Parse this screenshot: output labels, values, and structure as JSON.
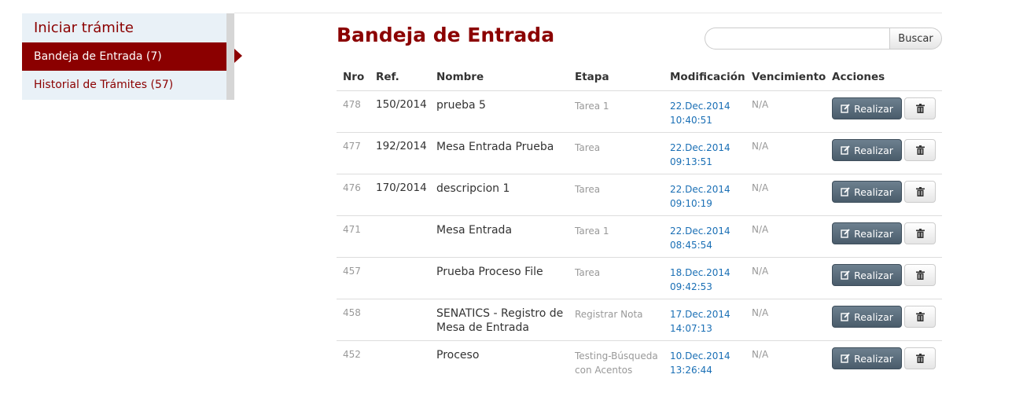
{
  "sidebar": {
    "start_label": "Iniciar trámite",
    "inbox_label": "Bandeja de Entrada (7)",
    "history_label": "Historial de Trámites (57)"
  },
  "main": {
    "title": "Bandeja de Entrada",
    "search": {
      "placeholder": "",
      "value": "",
      "button_label": "Buscar"
    }
  },
  "table": {
    "headers": {
      "nro": "Nro",
      "ref": "Ref.",
      "nombre": "Nombre",
      "etapa": "Etapa",
      "modificacion": "Modificación",
      "vencimiento": "Vencimiento",
      "acciones": "Acciones"
    },
    "rows": [
      {
        "nro": "478",
        "ref": "150/2014",
        "nombre": "prueba 5",
        "etapa": "Tarea 1",
        "fecha": "22.Dec.2014",
        "hora": "10:40:51",
        "vencimiento": "N/A",
        "accion": "Realizar"
      },
      {
        "nro": "477",
        "ref": "192/2014",
        "nombre": "Mesa Entrada Prueba",
        "etapa": "Tarea",
        "fecha": "22.Dec.2014",
        "hora": "09:13:51",
        "vencimiento": "N/A",
        "accion": "Realizar"
      },
      {
        "nro": "476",
        "ref": "170/2014",
        "nombre": "descripcion 1",
        "etapa": "Tarea",
        "fecha": "22.Dec.2014",
        "hora": "09:10:19",
        "vencimiento": "N/A",
        "accion": "Realizar"
      },
      {
        "nro": "471",
        "ref": "",
        "nombre": "Mesa Entrada",
        "etapa": "Tarea 1",
        "fecha": "22.Dec.2014",
        "hora": "08:45:54",
        "vencimiento": "N/A",
        "accion": "Realizar"
      },
      {
        "nro": "457",
        "ref": "",
        "nombre": "Prueba Proceso File",
        "etapa": "Tarea",
        "fecha": "18.Dec.2014",
        "hora": "09:42:53",
        "vencimiento": "N/A",
        "accion": "Realizar"
      },
      {
        "nro": "458",
        "ref": "",
        "nombre": "SENATICS - Registro de Mesa de Entrada",
        "etapa": "Registrar Nota",
        "fecha": "17.Dec.2014",
        "hora": "14:07:13",
        "vencimiento": "N/A",
        "accion": "Realizar"
      },
      {
        "nro": "452",
        "ref": "",
        "nombre": "Proceso",
        "etapa": "Testing-Búsqueda con Acentos",
        "fecha": "10.Dec.2014",
        "hora": "13:26:44",
        "vencimiento": "N/A",
        "accion": "Realizar"
      }
    ]
  },
  "icons": {
    "edit": "edit-icon",
    "delete": "trash-icon"
  },
  "colors": {
    "brand": "#8b0000",
    "link": "#1a6fb5",
    "action_button": "#5a6d7c"
  }
}
